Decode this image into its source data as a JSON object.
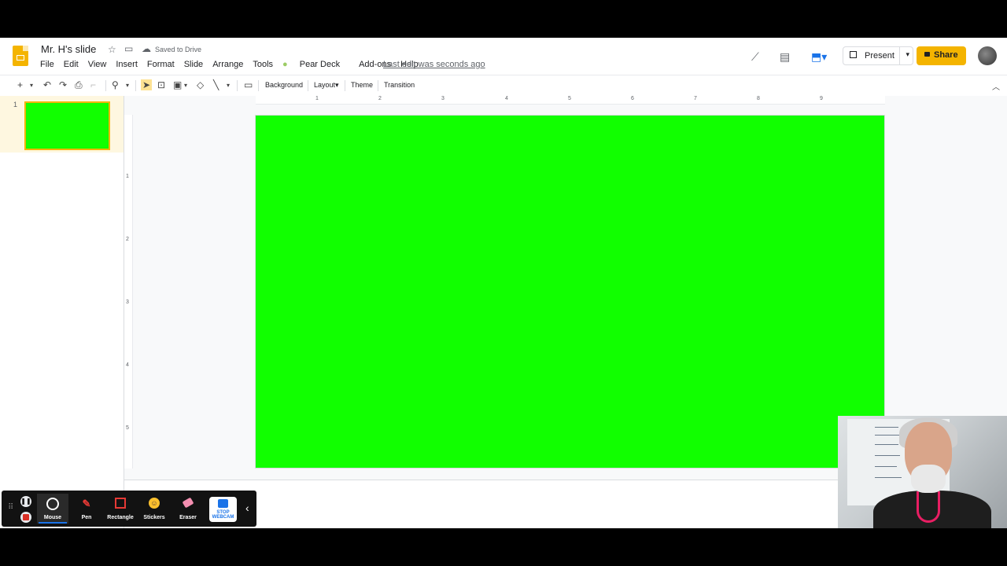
{
  "app": {
    "doc_title": "Mr. H's slide",
    "saved_status": "Saved to Drive",
    "last_edit": "Last edit was seconds ago",
    "present_label": "Present",
    "share_label": "Share"
  },
  "menu": [
    "File",
    "Edit",
    "View",
    "Insert",
    "Format",
    "Slide",
    "Arrange",
    "Tools",
    "Pear Deck",
    "Add-ons",
    "Help"
  ],
  "toolbar": {
    "background_label": "Background",
    "layout_label": "Layout",
    "theme_label": "Theme",
    "transition_label": "Transition"
  },
  "slides": [
    {
      "number": "1",
      "color": "#11ff00"
    }
  ],
  "ruler": {
    "horizontal": [
      "1",
      "2",
      "3",
      "4",
      "5",
      "6",
      "7",
      "8",
      "9"
    ],
    "vertical": [
      "1",
      "2",
      "3",
      "4",
      "5"
    ]
  },
  "slide_canvas": {
    "background": "#11ff00"
  },
  "recorder": {
    "tools": [
      "Mouse",
      "Pen",
      "Rectangle",
      "Stickers",
      "Eraser"
    ],
    "active_tool": "Mouse",
    "webcam_button": "STOP WEBCAM"
  },
  "colors": {
    "brand": "#f4b400",
    "slide_green": "#11ff00",
    "recorder_bg": "#121212",
    "accent_blue": "#1a73e8"
  }
}
